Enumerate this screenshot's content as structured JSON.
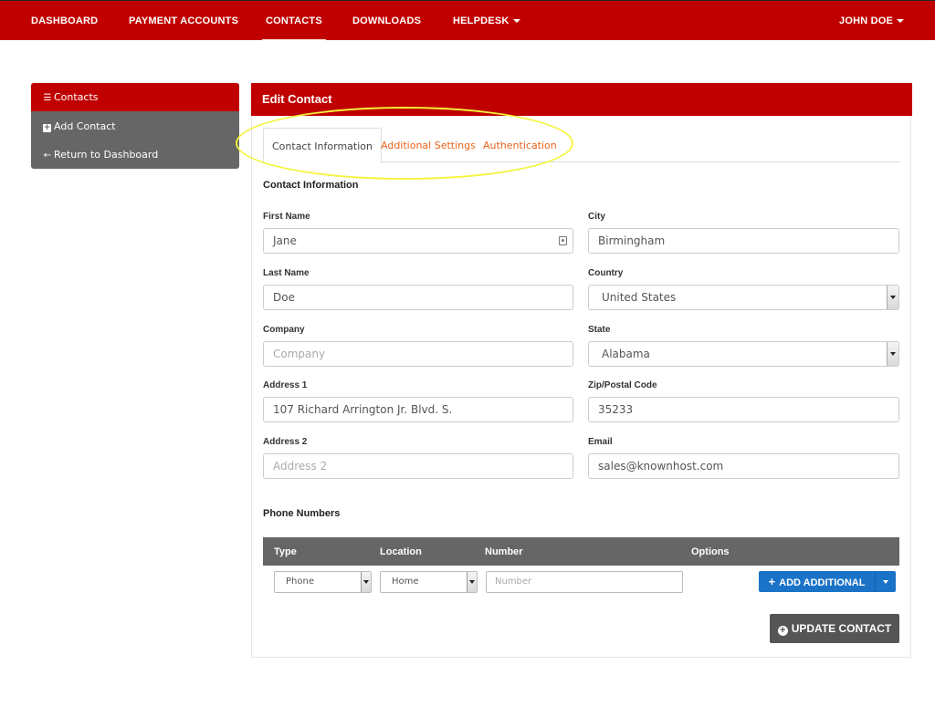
{
  "nav": {
    "dashboard": "DASHBOARD",
    "payment_accounts": "PAYMENT ACCOUNTS",
    "contacts": "CONTACTS",
    "downloads": "DOWNLOADS",
    "helpdesk": "HELPDESK",
    "user": "JOHN DOE"
  },
  "sidebar": {
    "contacts": "Contacts",
    "add_contact": "Add Contact",
    "return": "Return to Dashboard"
  },
  "panel": {
    "title": "Edit Contact",
    "tabs": [
      "Contact Information",
      "Additional Settings",
      "Authentication"
    ],
    "section_title": "Contact Information"
  },
  "form": {
    "first_name": {
      "label": "First Name",
      "value": "Jane"
    },
    "last_name": {
      "label": "Last Name",
      "value": "Doe"
    },
    "company": {
      "label": "Company",
      "placeholder": "Company"
    },
    "address1": {
      "label": "Address 1",
      "value": "107 Richard Arrington Jr. Blvd. S."
    },
    "address2": {
      "label": "Address 2",
      "placeholder": "Address 2"
    },
    "city": {
      "label": "City",
      "value": "Birmingham"
    },
    "country": {
      "label": "Country",
      "value": "United States"
    },
    "state": {
      "label": "State",
      "value": "Alabama"
    },
    "zip": {
      "label": "Zip/Postal Code",
      "value": "35233"
    },
    "email": {
      "label": "Email",
      "value": "sales@knownhost.com"
    }
  },
  "phones": {
    "title": "Phone Numbers",
    "columns": [
      "Type",
      "Location",
      "Number",
      "Options"
    ],
    "type_value": "Phone",
    "location_value": "Home",
    "number_placeholder": "Number",
    "add_label": "ADD ADDITIONAL"
  },
  "update_label": "UPDATE CONTACT",
  "colors": {
    "brand": "#c00000",
    "tab_link": "#e8631a",
    "primary": "#1a73c7",
    "highlight": "#f4f43c"
  }
}
